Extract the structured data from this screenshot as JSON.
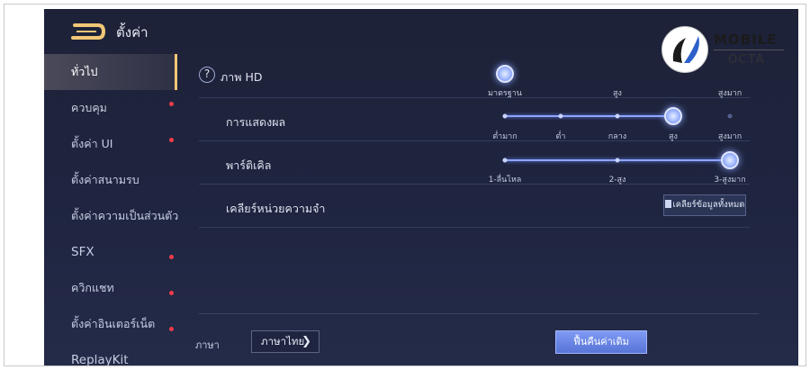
{
  "header": {
    "title": "ตั้งค่า"
  },
  "sidebar": {
    "items": [
      {
        "label": "ทั่วไป",
        "active": true,
        "dot": false
      },
      {
        "label": "ควบคุม",
        "active": false,
        "dot": true
      },
      {
        "label": "ตั้งค่า UI",
        "active": false,
        "dot": true
      },
      {
        "label": "ตั้งค่าสนามรบ",
        "active": false,
        "dot": false
      },
      {
        "label": "ตั้งค่าความเป็นส่วนตัว",
        "active": false,
        "dot": false
      },
      {
        "label": "SFX",
        "active": false,
        "dot": true
      },
      {
        "label": "ควิกแชท",
        "active": false,
        "dot": true
      },
      {
        "label": "ตั้งค่าอินเตอร์เน็ต",
        "active": false,
        "dot": true
      },
      {
        "label": "ReplayKit",
        "active": false,
        "dot": false
      }
    ]
  },
  "settings": {
    "hd": {
      "help": "?",
      "label": "ภาพ HD",
      "options": [
        "มาตรฐาน",
        "สูง",
        "สูงมาก"
      ],
      "selected_index": 0
    },
    "display": {
      "label": "การแสดงผล",
      "options": [
        "ต่ำมาก",
        "ต่ำ",
        "กลาง",
        "สูง",
        "สูงมาก"
      ],
      "selected_index": 3
    },
    "particle": {
      "label": "พาร์ติเคิล",
      "options": [
        "1-ลื่นไหล",
        "2-สูง",
        "3-สูงมาก"
      ],
      "selected_index": 2
    },
    "memory": {
      "label": "เคลียร์หน่วยความจำ",
      "button": "เคลียร์ข้อมูลทั้งหมด"
    }
  },
  "footer": {
    "language_label": "ภาษา",
    "language_value": "ภาษาไทย",
    "reset_button": "ฟื้นคืนค่าเดิม"
  },
  "watermark": {
    "line1": "MOBILE",
    "line2": "OCTA"
  },
  "colors": {
    "accent": "#f2c777",
    "badge": "#ee3c4a",
    "slider": "#8fa6ff",
    "reset": "#6a86e6"
  }
}
